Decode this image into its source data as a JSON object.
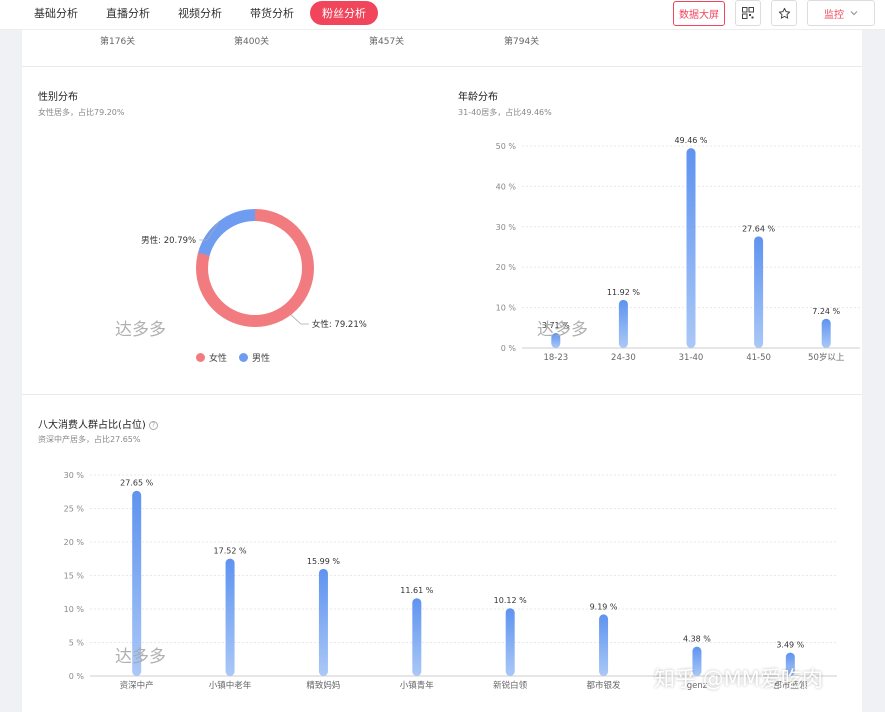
{
  "tabs": [
    {
      "label": "基础分析",
      "active": false
    },
    {
      "label": "直播分析",
      "active": false
    },
    {
      "label": "视频分析",
      "active": false
    },
    {
      "label": "带货分析",
      "active": false
    },
    {
      "label": "粉丝分析",
      "active": true
    }
  ],
  "actions": {
    "dashboard_label": "数据大屏",
    "qr_icon": "qrcode-icon",
    "star_icon": "star-icon",
    "monitor_label": "监控"
  },
  "colors": {
    "accent": "#f0455b",
    "female": "#f17b7f",
    "male": "#6e9cf0",
    "bar_top": "#5e93f0",
    "bar_bottom": "#aac8f7"
  },
  "ranks": [
    "第176关",
    "第400关",
    "第457关",
    "第794关"
  ],
  "gender": {
    "title": "性别分布",
    "subtitle": "女性居多，占比79.20%",
    "label_male": "男性: 20.79%",
    "label_female": "女性: 79.21%",
    "legend": [
      "女性",
      "男性"
    ],
    "watermark": "达多多"
  },
  "age": {
    "title": "年龄分布",
    "subtitle": "31-40居多，占比49.46%",
    "watermark": "达多多"
  },
  "consumer": {
    "title": "八大消费人群占比(占位)",
    "subtitle": "资深中产居多，占比27.65%",
    "watermark": "达多多"
  },
  "footer_watermark": "知乎 @MM爱吃肉",
  "chart_data": [
    {
      "type": "pie",
      "title": "性别分布",
      "categories": [
        "女性",
        "男性"
      ],
      "values": [
        79.21,
        20.79
      ],
      "legend": "bottom"
    },
    {
      "type": "bar",
      "title": "年龄分布",
      "categories": [
        "18-23",
        "24-30",
        "31-40",
        "41-50",
        "50岁以上"
      ],
      "values": [
        3.71,
        11.92,
        49.46,
        27.64,
        7.24
      ],
      "value_labels": [
        "3.71 %",
        "11.92 %",
        "49.46 %",
        "27.64 %",
        "7.24 %"
      ],
      "ylim": [
        0,
        50
      ],
      "yticks": [
        "0 %",
        "10 %",
        "20 %",
        "30 %",
        "40 %",
        "50 %"
      ],
      "grid": true
    },
    {
      "type": "bar",
      "title": "八大消费人群占比(占位)",
      "categories": [
        "资深中产",
        "小镇中老年",
        "精致妈妈",
        "小镇青年",
        "新锐白领",
        "都市银发",
        "genz",
        "都市蓝领"
      ],
      "values": [
        27.65,
        17.52,
        15.99,
        11.61,
        10.12,
        9.19,
        4.38,
        3.49
      ],
      "value_labels": [
        "27.65 %",
        "17.52 %",
        "15.99 %",
        "11.61 %",
        "10.12 %",
        "9.19 %",
        "4.38 %",
        "3.49 %"
      ],
      "ylim": [
        0,
        30
      ],
      "yticks": [
        "0 %",
        "5 %",
        "10 %",
        "15 %",
        "20 %",
        "25 %",
        "30 %"
      ],
      "grid": true
    }
  ]
}
